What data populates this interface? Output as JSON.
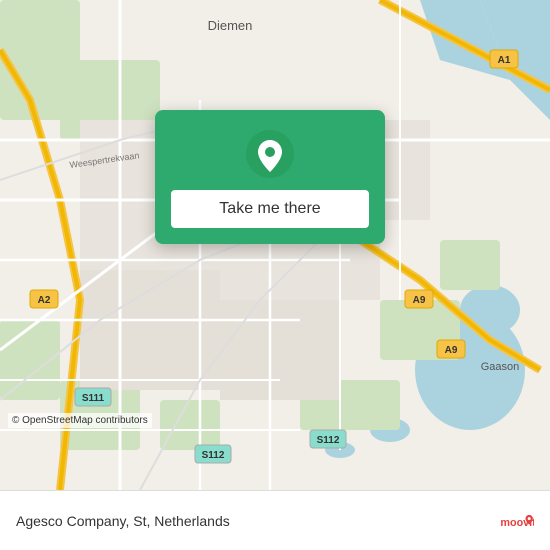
{
  "map": {
    "alt": "OpenStreetMap of Amsterdam area",
    "copyright": "© OpenStreetMap contributors"
  },
  "popup": {
    "button_label": "Take me there"
  },
  "bottom_bar": {
    "location_text": "Agesco Company, St, Netherlands",
    "logo_alt": "moovit"
  }
}
